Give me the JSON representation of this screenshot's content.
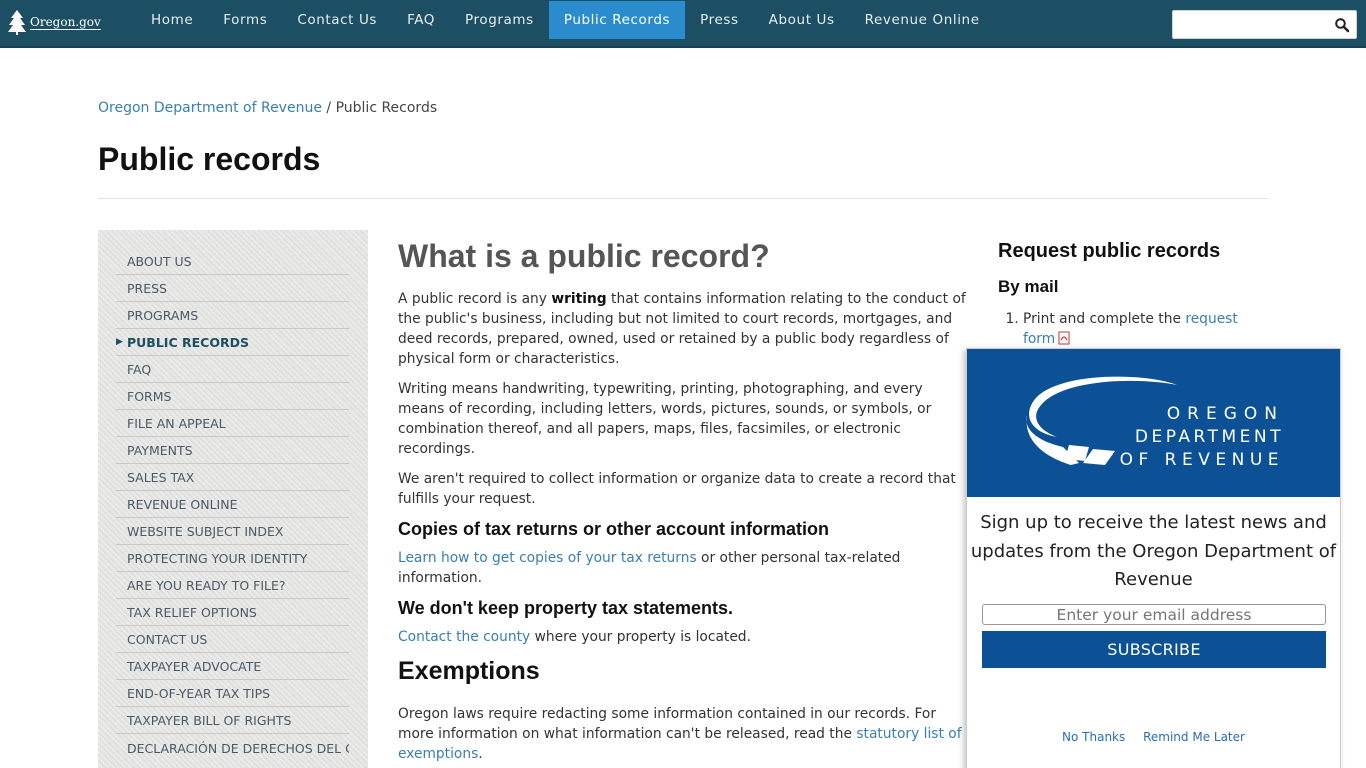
{
  "header": {
    "logo_text": "Oregon.gov",
    "nav": [
      {
        "label": "Home"
      },
      {
        "label": "Forms"
      },
      {
        "label": "Contact Us"
      },
      {
        "label": "FAQ"
      },
      {
        "label": "Programs"
      },
      {
        "label": "Public Records",
        "active": true
      },
      {
        "label": "Press"
      },
      {
        "label": "About Us"
      },
      {
        "label": "Revenue Online"
      }
    ],
    "search_placeholder": ""
  },
  "breadcrumb": {
    "parent": "Oregon Department of Revenue",
    "separator": " / ",
    "current": "Public Records"
  },
  "page_title": "Public records",
  "sidebar": {
    "active_marker": "▶",
    "items": [
      {
        "label": "ABOUT US"
      },
      {
        "label": "PRESS"
      },
      {
        "label": "PROGRAMS"
      },
      {
        "label": "PUBLIC RECORDS"
      },
      {
        "label": "FAQ"
      },
      {
        "label": "FORMS"
      },
      {
        "label": "FILE AN APPEAL"
      },
      {
        "label": "PAYMENTS"
      },
      {
        "label": "SALES TAX"
      },
      {
        "label": "REVENUE ONLINE"
      },
      {
        "label": "WEBSITE SUBJECT INDEX"
      },
      {
        "label": "PROTECTING YOUR IDENTITY"
      },
      {
        "label": "ARE YOU READY TO FILE?"
      },
      {
        "label": "TAX RELIEF OPTIONS"
      },
      {
        "label": "CONTACT US"
      },
      {
        "label": "TAXPAYER ADVOCATE"
      },
      {
        "label": "END-OF-YEAR TAX TIPS"
      },
      {
        "label": "TAXPAYER BILL OF RIGHTS"
      },
      {
        "label": "DECLARACIÓN DE DERECHOS DEL CONTRIBUYENTE"
      }
    ]
  },
  "main": {
    "heading": "What is a public record?",
    "p1_pre": "A public record is any ",
    "p1_bold": "writing",
    "p1_post": " that contains information relating to the conduct of the public's business, including but not limited to court records, mortgages, and deed records, prepared, owned, used or retained by a public body regardless of physical form or characteristics.",
    "p2": "Writing means handwriting, typewriting, printing, photographing, and every means of recording, including letters, words, pictures, sounds, or symbols, or combination thereof, and all papers, maps, files, facsimiles, or electronic recordings.",
    "p3": "We aren't required to collect information or organize data to create a record that fulfills your request.",
    "copies_heading": "Copies of tax returns or other account information",
    "copies_link": "Learn how to get copies of your tax returns",
    "copies_rest": " or other personal tax-related information.",
    "property_heading": "We don't keep property tax statements.",
    "county_link": "Contact the county",
    "county_rest": " where your property is located.",
    "exemptions_heading": "Exemptions",
    "exemptions_text": "Oregon laws require redacting some information contained in our records. For more information on what information can't be released, read the ",
    "exemptions_link": "statutory list of exemptions",
    "exemptions_end": "."
  },
  "right": {
    "heading": "Request public records",
    "subheading": "By mail",
    "step1_pre": "Print and complete the ",
    "step1_link": "request form"
  },
  "popup": {
    "logo_line1": "OREGON",
    "logo_line2": "DEPARTMENT",
    "logo_line3": "OF REVENUE",
    "text": "Sign up to receive the latest news and updates from the Oregon Department of Revenue",
    "email_placeholder": "Enter your email address",
    "subscribe": "SUBSCRIBE",
    "no_thanks": "No Thanks",
    "remind_later": "Remind Me Later",
    "brand_color": "#0c5196"
  }
}
